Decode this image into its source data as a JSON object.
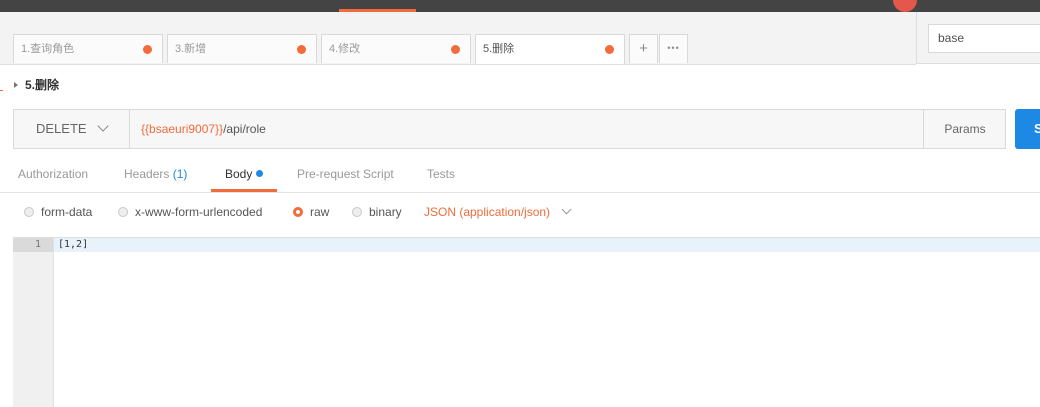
{
  "tabs": [
    {
      "label": "1.查询角色",
      "active": false
    },
    {
      "label": "3.新增",
      "active": false
    },
    {
      "label": "4.修改",
      "active": false
    },
    {
      "label": "5.删除",
      "active": true
    }
  ],
  "tab_actions": {
    "add_icon": "plus-icon",
    "more_icon": "ellipsis-icon",
    "add_glyph": "+",
    "more_glyph": "•••"
  },
  "environment": {
    "value": "base"
  },
  "request": {
    "name": "5.删除",
    "method": "DELETE",
    "url_variable": "{{bsaeuri9007}}",
    "url_path": "/api/role",
    "params_label": "Params",
    "send_label": "S"
  },
  "subtabs": {
    "authorization": "Authorization",
    "headers": "Headers",
    "headers_count": "(1)",
    "body": "Body",
    "prerequest": "Pre-request Script",
    "tests": "Tests"
  },
  "body_modes": {
    "form_data": "form-data",
    "urlencoded": "x-www-form-urlencoded",
    "raw": "raw",
    "binary": "binary",
    "selected": "raw",
    "content_type": "JSON (application/json)"
  },
  "editor": {
    "lines": [
      {
        "number": "1",
        "text": "[1,2]"
      }
    ]
  },
  "colors": {
    "accent": "#f26b3a",
    "primary": "#1e88e5"
  }
}
